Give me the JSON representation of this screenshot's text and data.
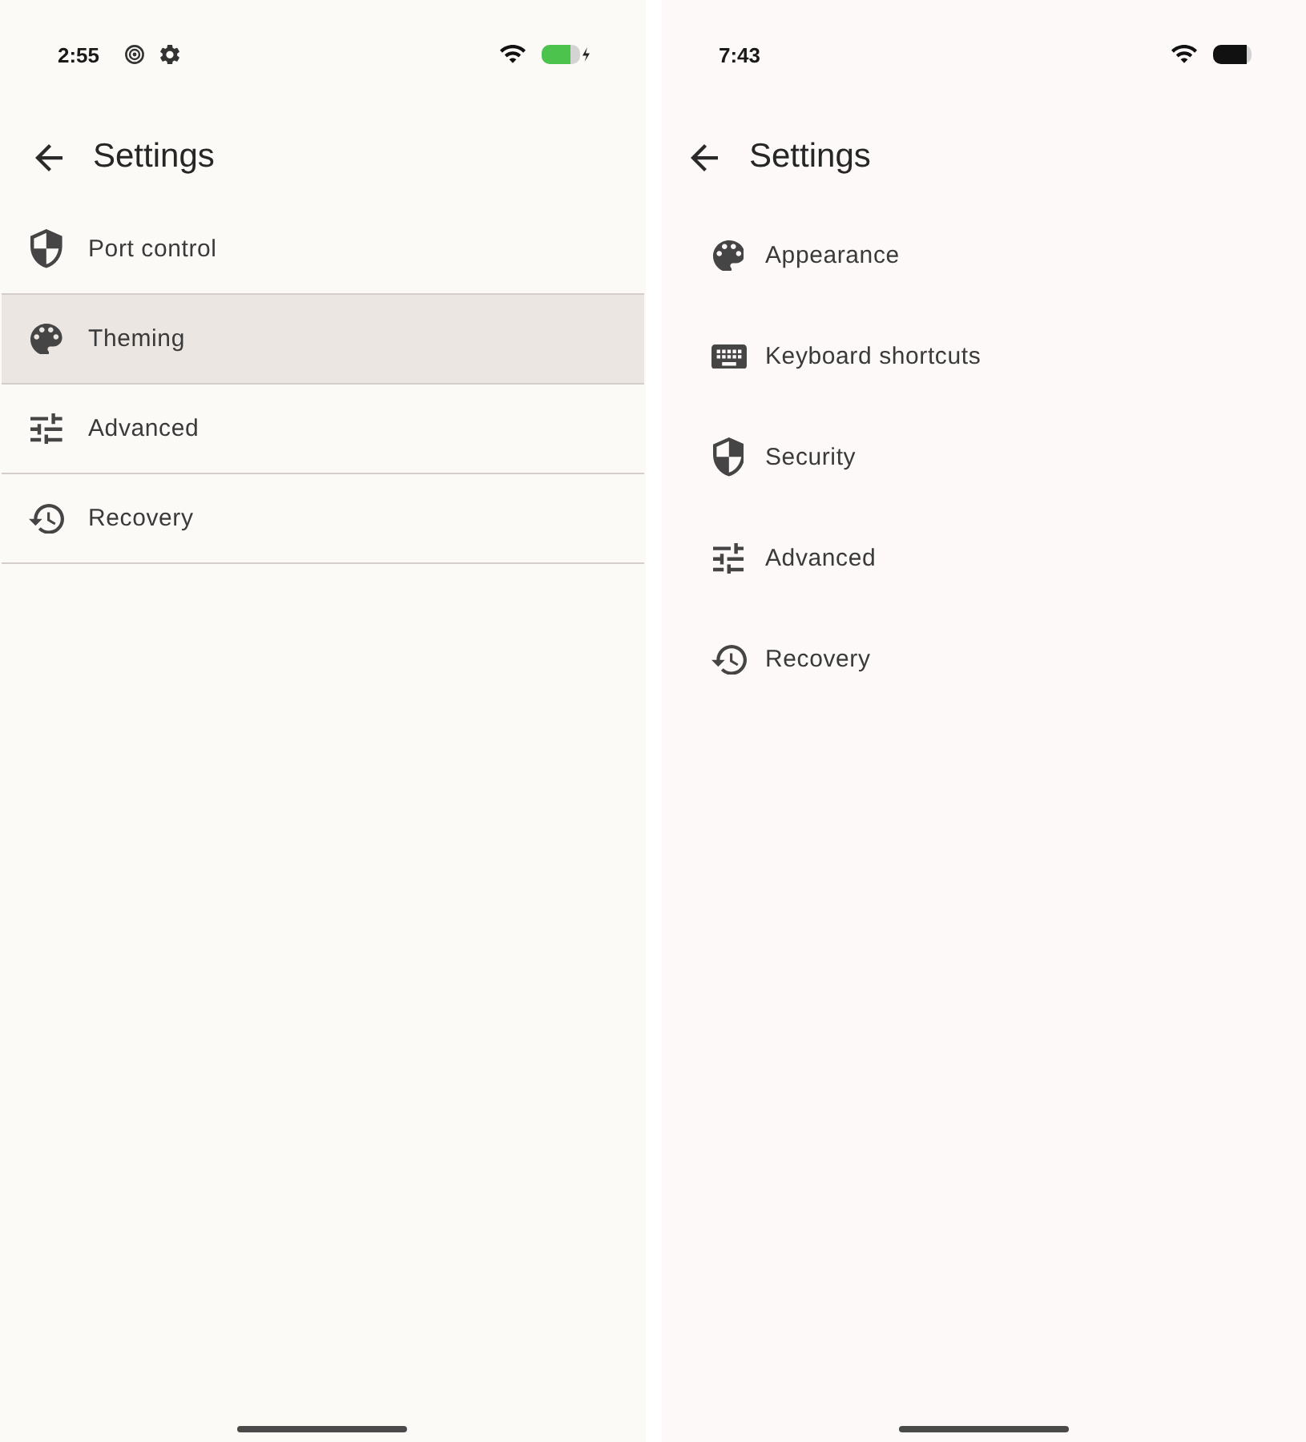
{
  "phones": [
    {
      "status_bar": {
        "time": "2:55",
        "notification_icons": [
          {
            "kind": "target"
          },
          {
            "kind": "gear"
          }
        ],
        "charging": true
      },
      "header": {
        "title": "Settings"
      },
      "settings_list": {
        "dividers": true,
        "items": [
          {
            "kind": "shield",
            "label": "Port control",
            "selected": false
          },
          {
            "kind": "palette",
            "label": "Theming",
            "selected": true
          },
          {
            "kind": "sliders",
            "label": "Advanced",
            "selected": false
          },
          {
            "kind": "history",
            "label": "Recovery",
            "selected": false
          }
        ]
      }
    },
    {
      "status_bar": {
        "time": "7:43",
        "charging": false
      },
      "header": {
        "title": "Settings"
      },
      "settings_list": {
        "dividers": false,
        "items": [
          {
            "kind": "palette",
            "label": "Appearance",
            "selected": false
          },
          {
            "kind": "keyboard",
            "label": "Keyboard shortcuts",
            "selected": false
          },
          {
            "kind": "shield",
            "label": "Security",
            "selected": false
          },
          {
            "kind": "sliders",
            "label": "Advanced",
            "selected": false
          },
          {
            "kind": "history",
            "label": "Recovery",
            "selected": false
          }
        ]
      }
    }
  ]
}
